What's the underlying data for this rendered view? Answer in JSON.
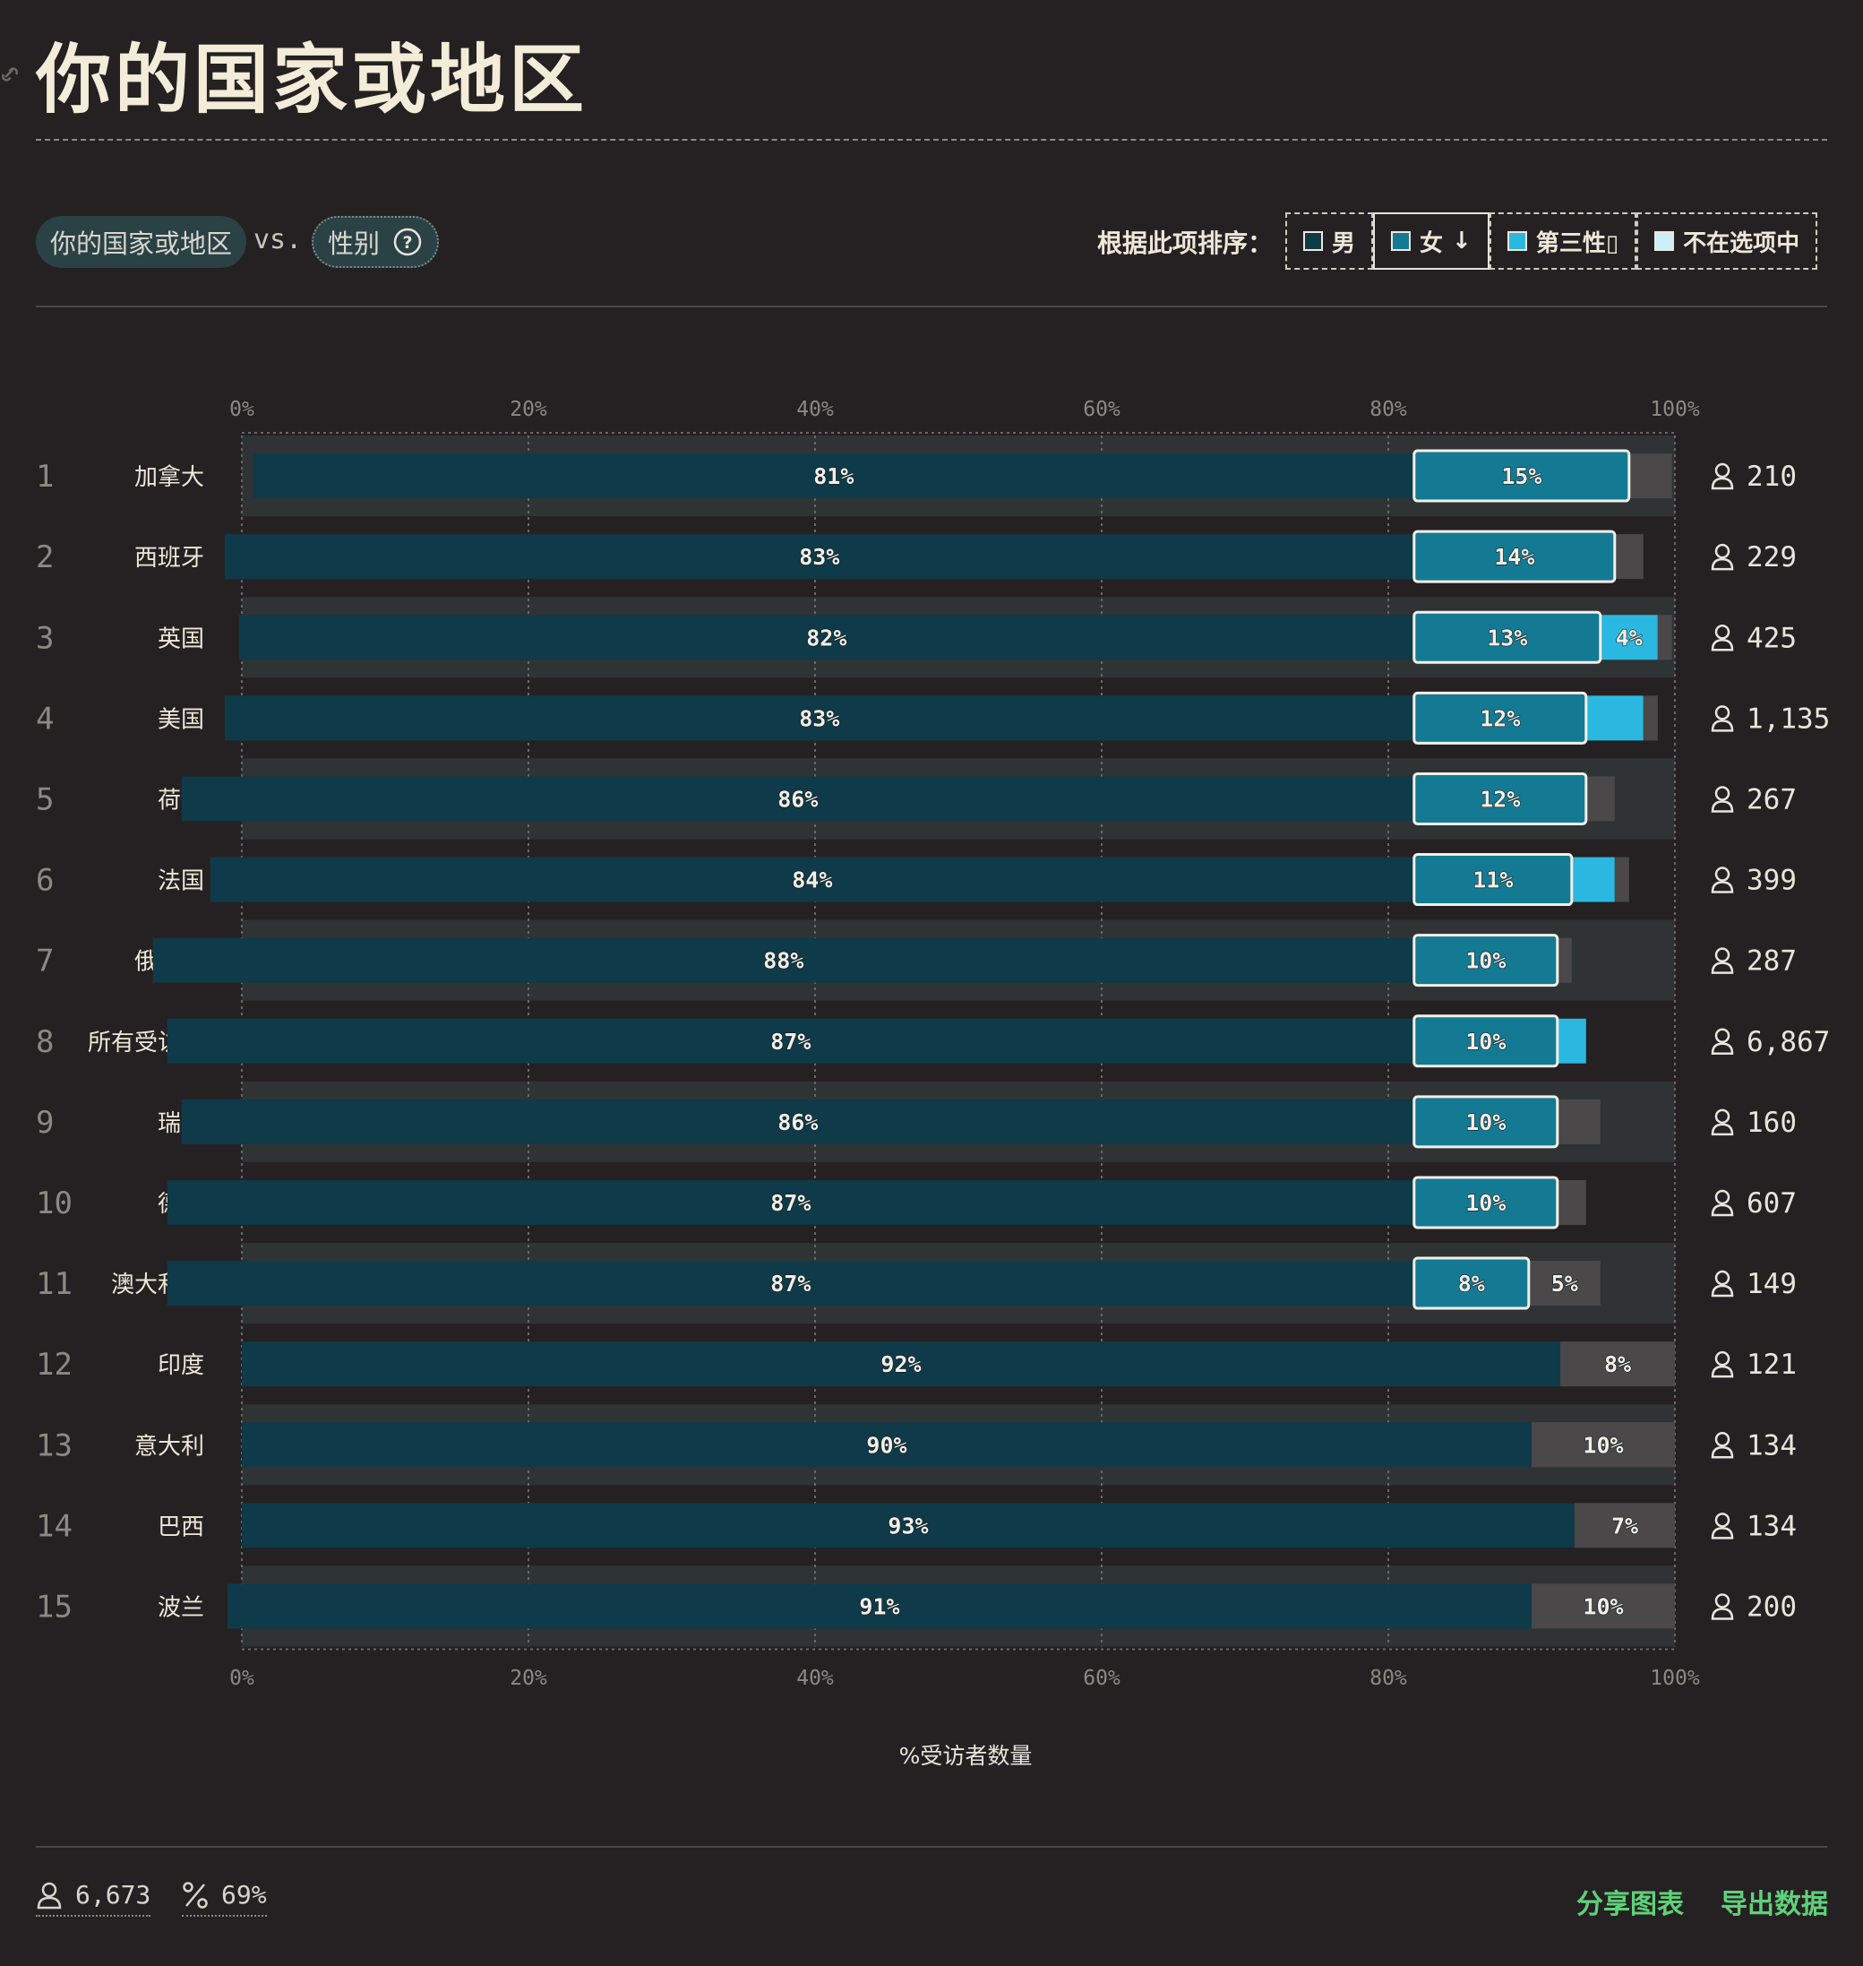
{
  "page": {
    "title": "你的国家或地区",
    "filter_a": "你的国家或地区",
    "vs": "vs.",
    "filter_b": "性别",
    "sort_label": "根据此项排序：",
    "sort_options": [
      {
        "label": "男",
        "color": "#0f3a49"
      },
      {
        "label": "女",
        "arrow": "↓",
        "color": "#147a94",
        "active": true
      },
      {
        "label": "第三性",
        "suffix": "▯",
        "color": "#2bb8e0"
      },
      {
        "label": "不在选项中",
        "color": "#c8f1fb"
      }
    ],
    "footer": {
      "respondents": "6,673",
      "percent": "69%",
      "share": "分享图表",
      "export": "导出数据"
    }
  },
  "colors": {
    "male": "#0f3a49",
    "female": "#147a94",
    "third": "#2bb8e0",
    "other": "#4a4849",
    "accent_green": "#5fd17a",
    "background": "#252122"
  },
  "chart_data": {
    "type": "bar",
    "orientation": "horizontal",
    "stacked": true,
    "xlabel": "%受访者数量",
    "xlim": [
      0,
      100
    ],
    "ticks": [
      "0%",
      "20%",
      "40%",
      "60%",
      "80%",
      "100%"
    ],
    "series_names": [
      "男",
      "女",
      "第三性",
      "不在选项中"
    ],
    "rows": [
      {
        "rank": "1",
        "name": "加拿大",
        "male": 81,
        "female": 15,
        "third": 0,
        "other": 3,
        "labels": {
          "male": "81%",
          "female": "15%"
        },
        "count": "210"
      },
      {
        "rank": "2",
        "name": "西班牙",
        "male": 83,
        "female": 14,
        "third": 0,
        "other": 2,
        "labels": {
          "male": "83%",
          "female": "14%"
        },
        "count": "229"
      },
      {
        "rank": "3",
        "name": "英国",
        "male": 82,
        "female": 13,
        "third": 4,
        "other": 1,
        "labels": {
          "male": "82%",
          "female": "13%",
          "third": "4%"
        },
        "count": "425"
      },
      {
        "rank": "4",
        "name": "美国",
        "male": 83,
        "female": 12,
        "third": 4,
        "other": 1,
        "labels": {
          "male": "83%",
          "female": "12%"
        },
        "count": "1,135"
      },
      {
        "rank": "5",
        "name": "荷兰",
        "male": 86,
        "female": 12,
        "third": 0,
        "other": 2,
        "labels": {
          "male": "86%",
          "female": "12%"
        },
        "count": "267"
      },
      {
        "rank": "6",
        "name": "法国",
        "male": 84,
        "female": 11,
        "third": 3,
        "other": 1,
        "labels": {
          "male": "84%",
          "female": "11%"
        },
        "count": "399"
      },
      {
        "rank": "7",
        "name": "俄罗斯",
        "male": 88,
        "female": 10,
        "third": 0,
        "other": 1,
        "labels": {
          "male": "88%",
          "female": "10%"
        },
        "count": "287"
      },
      {
        "rank": "8",
        "name": "所有受访者",
        "male": 87,
        "female": 10,
        "third": 2,
        "other": 0,
        "labels": {
          "male": "87%",
          "female": "10%"
        },
        "count": "6,867"
      },
      {
        "rank": "9",
        "name": "瑞典",
        "male": 86,
        "female": 10,
        "third": 0,
        "other": 3,
        "labels": {
          "male": "86%",
          "female": "10%"
        },
        "count": "160"
      },
      {
        "rank": "10",
        "name": "德国",
        "male": 87,
        "female": 10,
        "third": 0,
        "other": 2,
        "labels": {
          "male": "87%",
          "female": "10%"
        },
        "count": "607"
      },
      {
        "rank": "11",
        "name": "澳大利亚",
        "male": 87,
        "female": 8,
        "third": 0,
        "other": 5,
        "labels": {
          "male": "87%",
          "female": "8%",
          "other": "5%"
        },
        "count": "149"
      },
      {
        "rank": "12",
        "name": "印度",
        "male": 92,
        "female": 0,
        "third": 0,
        "other": 8,
        "labels": {
          "male": "92%",
          "other": "8%"
        },
        "count": "121"
      },
      {
        "rank": "13",
        "name": "意大利",
        "male": 90,
        "female": 0,
        "third": 0,
        "other": 10,
        "labels": {
          "male": "90%",
          "other": "10%"
        },
        "count": "134"
      },
      {
        "rank": "14",
        "name": "巴西",
        "male": 93,
        "female": 0,
        "third": 0,
        "other": 7,
        "labels": {
          "male": "93%",
          "other": "7%"
        },
        "count": "134"
      },
      {
        "rank": "15",
        "name": "波兰",
        "male": 91,
        "female": 0,
        "third": 0,
        "other": 10,
        "labels": {
          "male": "91%",
          "other": "10%"
        },
        "count": "200"
      }
    ]
  }
}
